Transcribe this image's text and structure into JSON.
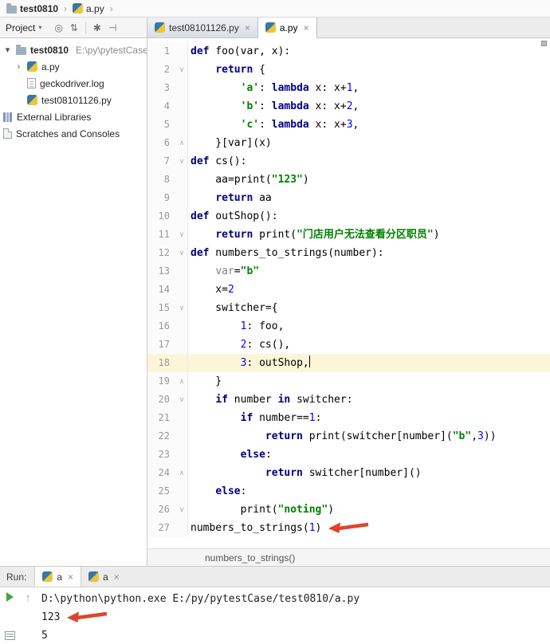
{
  "colors": {
    "keyword": "#000080",
    "string": "#008000",
    "number": "#0000ff",
    "unused": "#808080",
    "arrow": "#e0432d",
    "current_line": "#fcf5d8"
  },
  "nav": {
    "crumbs": [
      {
        "label": "test0810",
        "icon": "project-icon"
      },
      {
        "label": "a.py",
        "icon": "python-file-icon"
      }
    ]
  },
  "project_panel": {
    "title": "Project",
    "toolbar_icons": [
      {
        "name": "locate-file-icon",
        "glyph": "◎"
      },
      {
        "name": "collapse-all-icon",
        "glyph": "⇅"
      },
      {
        "name": "settings-icon",
        "glyph": "✱"
      },
      {
        "name": "hide-panel-icon",
        "glyph": "⊣"
      }
    ],
    "tree": [
      {
        "label": "test0810",
        "path": "E:\\py\\pytestCase",
        "icon": "folder",
        "arrow": "open",
        "indent": 0,
        "bold": true
      },
      {
        "label": "a.py",
        "icon": "python",
        "arrow": "closed",
        "indent": 1
      },
      {
        "label": "geckodriver.log",
        "icon": "textfile",
        "indent": 1
      },
      {
        "label": "test08101126.py",
        "icon": "python",
        "indent": 1
      },
      {
        "label": "External Libraries",
        "icon": "libraries",
        "indent": 0
      },
      {
        "label": "Scratches and Consoles",
        "icon": "scratches",
        "indent": 0
      }
    ]
  },
  "editor": {
    "tabs": [
      {
        "label": "test08101126.py",
        "active": false
      },
      {
        "label": "a.py",
        "active": true
      }
    ],
    "breadcrumb": "numbers_to_strings()",
    "lines": [
      {
        "n": 1,
        "t": [
          [
            "k",
            "def"
          ],
          [
            "p",
            " foo(var, x):"
          ]
        ]
      },
      {
        "n": 2,
        "f": "v",
        "t": [
          [
            "p",
            "    "
          ],
          [
            "k",
            "return"
          ],
          [
            "p",
            " {"
          ]
        ]
      },
      {
        "n": 3,
        "t": [
          [
            "p",
            "        "
          ],
          [
            "s",
            "'a'"
          ],
          [
            "p",
            ": "
          ],
          [
            "k",
            "lambda"
          ],
          [
            "p",
            " x: x+"
          ],
          [
            "n",
            "1"
          ],
          [
            "p",
            ","
          ]
        ]
      },
      {
        "n": 4,
        "t": [
          [
            "p",
            "        "
          ],
          [
            "s",
            "'b'"
          ],
          [
            "p",
            ": "
          ],
          [
            "k",
            "lambda"
          ],
          [
            "p",
            " x: x+"
          ],
          [
            "n",
            "2"
          ],
          [
            "p",
            ","
          ]
        ]
      },
      {
        "n": 5,
        "t": [
          [
            "p",
            "        "
          ],
          [
            "s",
            "'c'"
          ],
          [
            "p",
            ": "
          ],
          [
            "k",
            "lambda"
          ],
          [
            "p",
            " x: x+"
          ],
          [
            "n",
            "3"
          ],
          [
            "p",
            ","
          ]
        ]
      },
      {
        "n": 6,
        "f": "^",
        "t": [
          [
            "p",
            "    }[var](x)"
          ]
        ]
      },
      {
        "n": 7,
        "f": "v",
        "t": [
          [
            "k",
            "def"
          ],
          [
            "p",
            " cs():"
          ]
        ]
      },
      {
        "n": 8,
        "t": [
          [
            "p",
            "    aa=print("
          ],
          [
            "s",
            "\"123\""
          ],
          [
            "p",
            ")"
          ]
        ]
      },
      {
        "n": 9,
        "t": [
          [
            "p",
            "    "
          ],
          [
            "k",
            "return"
          ],
          [
            "p",
            " aa"
          ]
        ]
      },
      {
        "n": 10,
        "t": [
          [
            "k",
            "def"
          ],
          [
            "p",
            " outShop():"
          ]
        ]
      },
      {
        "n": 11,
        "f": "v",
        "t": [
          [
            "p",
            "    "
          ],
          [
            "k",
            "return"
          ],
          [
            "p",
            " print("
          ],
          [
            "s",
            "\"门店用户无法查看分区职员\""
          ],
          [
            "p",
            ")"
          ]
        ]
      },
      {
        "n": 12,
        "f": "v",
        "t": [
          [
            "k",
            "def"
          ],
          [
            "p",
            " numbers_to_strings(number):"
          ]
        ]
      },
      {
        "n": 13,
        "t": [
          [
            "p",
            "    "
          ],
          [
            "g",
            "var"
          ],
          [
            "p",
            "="
          ],
          [
            "s",
            "\"b\""
          ]
        ]
      },
      {
        "n": 14,
        "t": [
          [
            "p",
            "    x="
          ],
          [
            "n",
            "2"
          ]
        ]
      },
      {
        "n": 15,
        "f": "v",
        "t": [
          [
            "p",
            "    switcher={"
          ]
        ]
      },
      {
        "n": 16,
        "t": [
          [
            "p",
            "        "
          ],
          [
            "n",
            "1"
          ],
          [
            "p",
            ": foo,"
          ]
        ]
      },
      {
        "n": 17,
        "t": [
          [
            "p",
            "        "
          ],
          [
            "n",
            "2"
          ],
          [
            "p",
            ": cs(),"
          ]
        ]
      },
      {
        "n": 18,
        "cur": true,
        "caret": true,
        "t": [
          [
            "p",
            "        "
          ],
          [
            "n",
            "3"
          ],
          [
            "p",
            ": outShop,"
          ]
        ]
      },
      {
        "n": 19,
        "f": "^",
        "t": [
          [
            "p",
            "    }"
          ]
        ]
      },
      {
        "n": 20,
        "f": "v",
        "t": [
          [
            "p",
            "    "
          ],
          [
            "k",
            "if"
          ],
          [
            "p",
            " number "
          ],
          [
            "k",
            "in"
          ],
          [
            "p",
            " switcher:"
          ]
        ]
      },
      {
        "n": 21,
        "t": [
          [
            "p",
            "        "
          ],
          [
            "k",
            "if"
          ],
          [
            "p",
            " number=="
          ],
          [
            "n",
            "1"
          ],
          [
            "p",
            ":"
          ]
        ]
      },
      {
        "n": 22,
        "t": [
          [
            "p",
            "            "
          ],
          [
            "k",
            "return"
          ],
          [
            "p",
            " print(switcher[number]("
          ],
          [
            "s",
            "\"b\""
          ],
          [
            "p",
            ","
          ],
          [
            "n",
            "3"
          ],
          [
            "p",
            "))"
          ]
        ]
      },
      {
        "n": 23,
        "t": [
          [
            "p",
            "        "
          ],
          [
            "k",
            "else"
          ],
          [
            "p",
            ":"
          ]
        ]
      },
      {
        "n": 24,
        "f": "^",
        "t": [
          [
            "p",
            "            "
          ],
          [
            "k",
            "return"
          ],
          [
            "p",
            " switcher[number]()"
          ]
        ]
      },
      {
        "n": 25,
        "t": [
          [
            "p",
            "    "
          ],
          [
            "k",
            "else"
          ],
          [
            "p",
            ":"
          ]
        ]
      },
      {
        "n": 26,
        "f": "v",
        "t": [
          [
            "p",
            "        print("
          ],
          [
            "s",
            "\"noting\""
          ],
          [
            "p",
            ")"
          ]
        ]
      },
      {
        "n": 27,
        "arrow": true,
        "t": [
          [
            "p",
            "numbers_to_strings("
          ],
          [
            "n",
            "1"
          ],
          [
            "p",
            ")"
          ]
        ]
      }
    ]
  },
  "run_panel": {
    "label": "Run:",
    "tabs": [
      {
        "label": "a",
        "active": true
      },
      {
        "label": "a",
        "active": false
      }
    ],
    "console": [
      {
        "text": "D:\\python\\python.exe E:/py/pytestCase/test0810/a.py"
      },
      {
        "text": "123",
        "arrow": true
      },
      {
        "text": "5"
      }
    ]
  }
}
